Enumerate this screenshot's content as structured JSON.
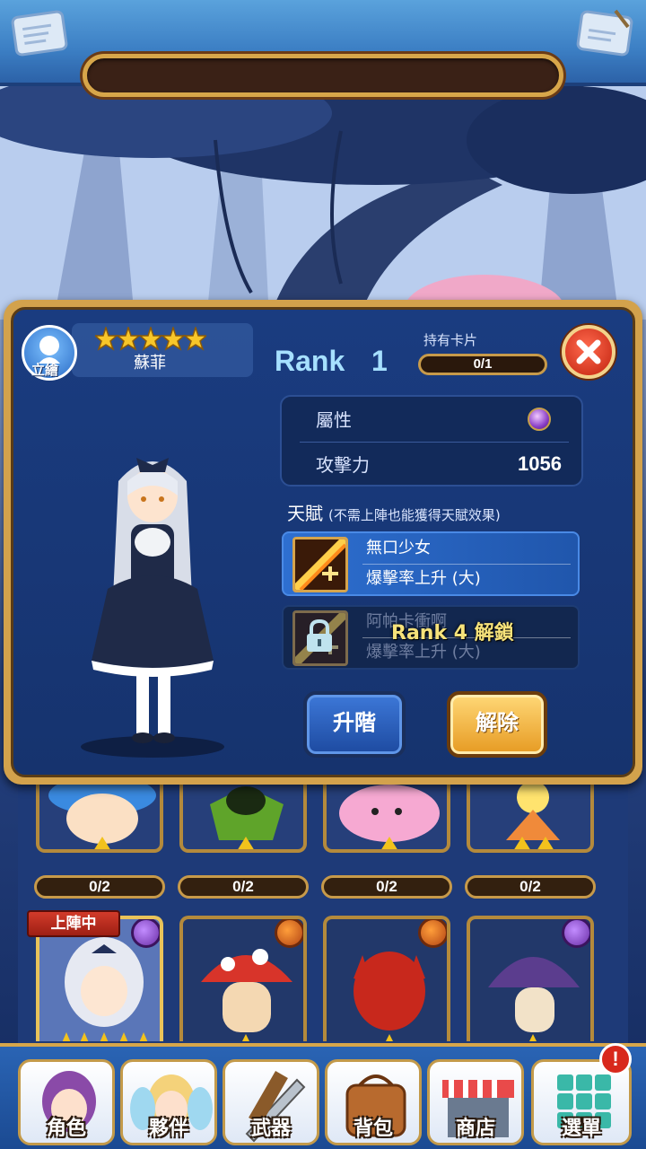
{
  "character": {
    "portrait_label": "立繪",
    "name": "蘇菲",
    "stars": 5,
    "rank_label": "Rank",
    "rank_value": "1",
    "cards_label": "持有卡片",
    "cards_value": "0/1"
  },
  "stats": {
    "attribute_label": "屬性",
    "attack_label": "攻擊力",
    "attack_value": "1056"
  },
  "talent": {
    "title": "天賦",
    "subtitle": "(不需上陣也能獲得天賦效果)",
    "items": [
      {
        "name": "無口少女",
        "desc": "爆擊率上升 (大)"
      },
      {
        "name": "阿帕卡衝啊",
        "desc": "爆擊率上升 (大)",
        "lock_text": "Rank 4 解鎖"
      }
    ]
  },
  "actions": {
    "upgrade_label": "升階",
    "release_label": "解除"
  },
  "grid": {
    "counts": [
      "0/2",
      "0/2",
      "0/2",
      "0/2"
    ],
    "active_ribbon": "上陣中"
  },
  "nav": {
    "items": [
      "角色",
      "夥伴",
      "武器",
      "背包",
      "商店",
      "選單"
    ],
    "notification": "!"
  },
  "colors": {
    "accent": "#d3a24c",
    "panel": "#1a3c80",
    "rank": "#a6e0ff",
    "release": "#f3b33e"
  }
}
